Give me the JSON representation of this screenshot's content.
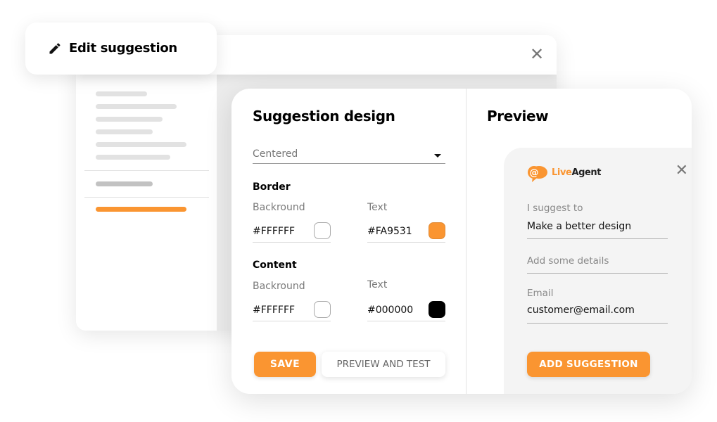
{
  "header": {
    "title": "Edit suggestion",
    "icon": "pencil-icon",
    "close_icon": "close-icon"
  },
  "design": {
    "title": "Suggestion design",
    "layout_select": {
      "value": "Centered"
    },
    "border": {
      "label": "Border",
      "background_label": "Backround",
      "background_value": "#FFFFFF",
      "text_label": "Text",
      "text_value": "#FA9531"
    },
    "content": {
      "label": "Content",
      "background_label": "Backround",
      "background_value": "#FFFFFF",
      "text_label": "Text",
      "text_value": "#000000"
    },
    "save_label": "SAVE",
    "preview_label": "PREVIEW AND TEST"
  },
  "preview": {
    "title": "Preview",
    "widget": {
      "brand_live": "Live",
      "brand_agent": "Agent",
      "suggest_label": "I suggest to",
      "suggest_value": "Make a better design",
      "details_placeholder": "Add some details",
      "email_label": "Email",
      "email_value": "customer@email.com",
      "add_label": "ADD SUGGESTION"
    }
  },
  "colors": {
    "accent": "#FA9531",
    "skeleton": "#E2E2E2"
  }
}
